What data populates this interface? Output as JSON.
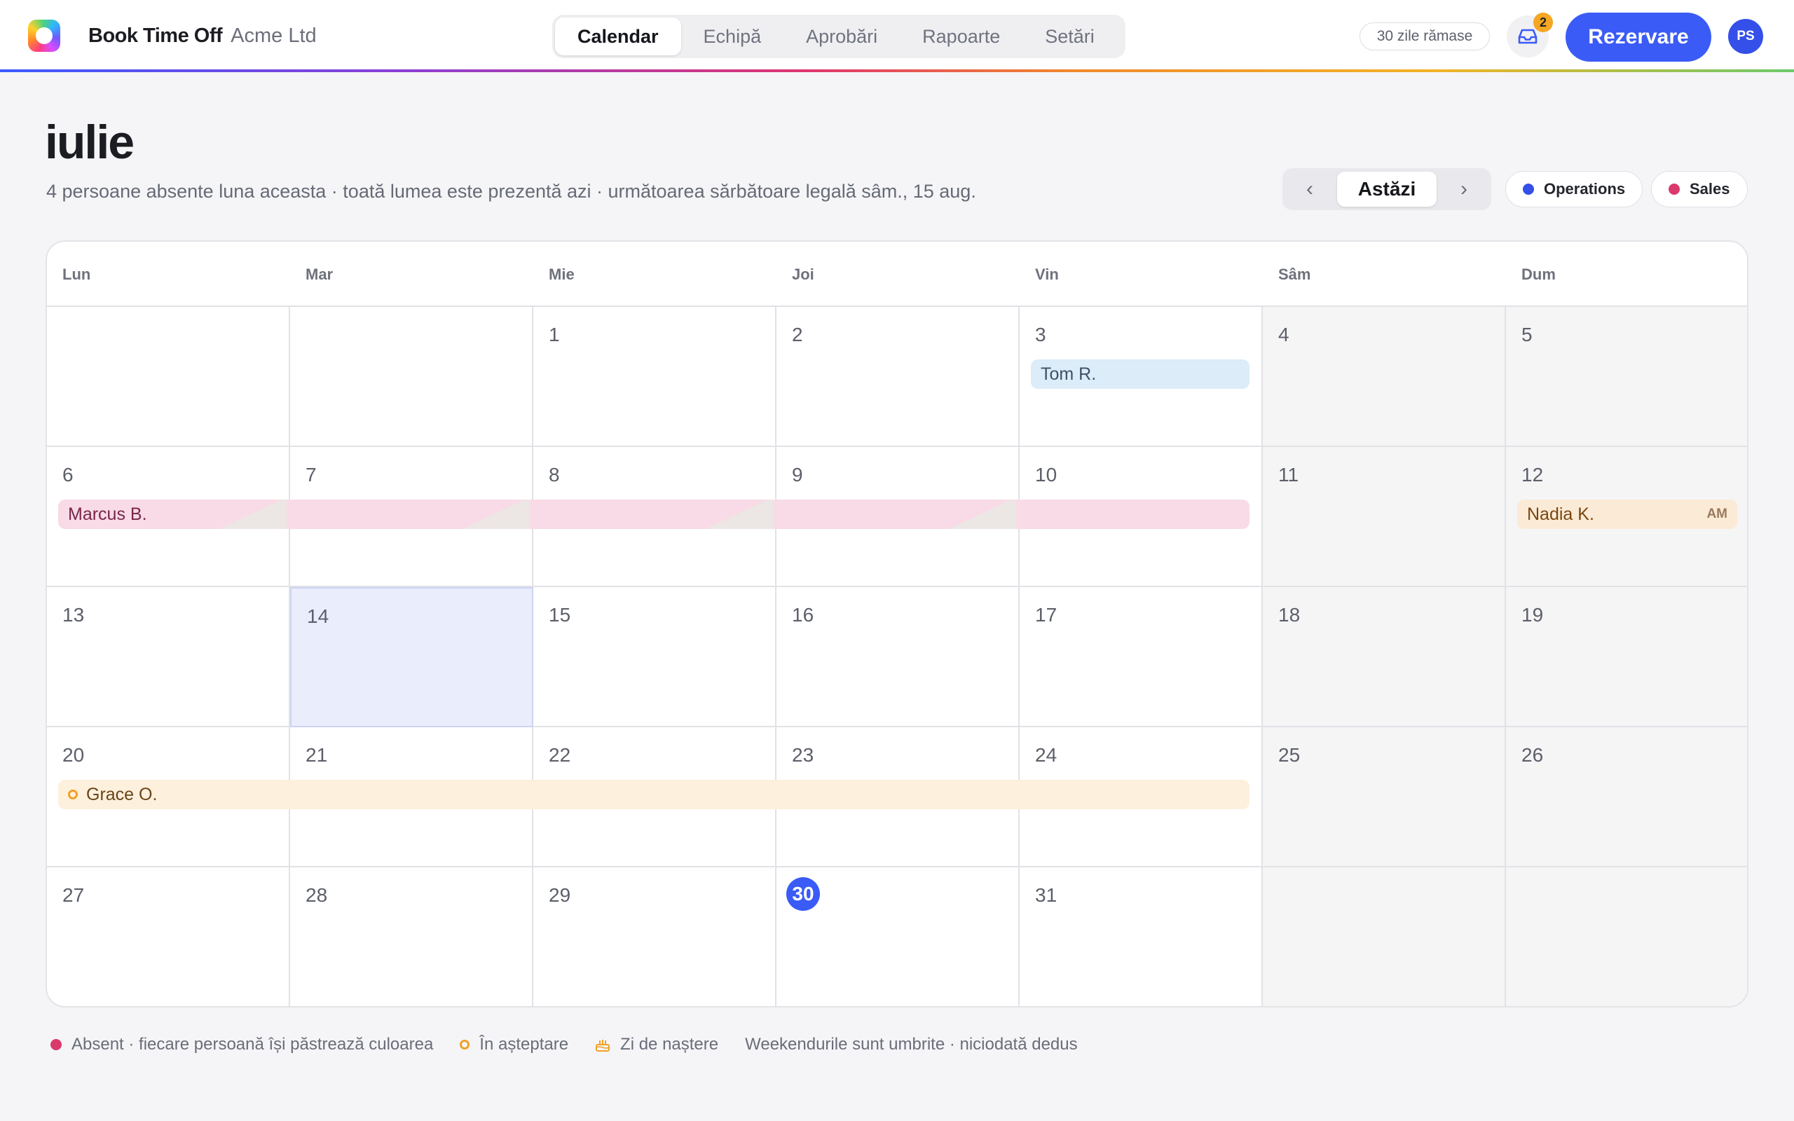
{
  "app": {
    "name": "Book Time Off",
    "org": "Acme Ltd"
  },
  "nav": {
    "tabs": [
      {
        "label": "Calendar",
        "active": true
      },
      {
        "label": "Echipă",
        "active": false
      },
      {
        "label": "Aprobări",
        "active": false
      },
      {
        "label": "Rapoarte",
        "active": false
      },
      {
        "label": "Setări",
        "active": false
      }
    ]
  },
  "header": {
    "days_left": "30 zile rămase",
    "inbox_count": "2",
    "book_label": "Rezervare",
    "avatar_initials": "PS"
  },
  "page": {
    "month": "iulie",
    "subtitle": "4 persoane absente luna aceasta · toată lumea este prezentă azi · următoarea sărbătoare legală sâm., 15 aug.",
    "prev_icon": "‹",
    "today_label": "Astăzi",
    "next_icon": "›",
    "teams": [
      {
        "label": "Operations",
        "color": "#3450e8"
      },
      {
        "label": "Sales",
        "color": "#d93a6b"
      }
    ]
  },
  "calendar": {
    "weekdays": [
      "Lun",
      "Mar",
      "Mie",
      "Joi",
      "Vin",
      "Sâm",
      "Dum"
    ],
    "weeks": [
      [
        "",
        "",
        "1",
        "2",
        "3",
        "4",
        "5"
      ],
      [
        "6",
        "7",
        "8",
        "9",
        "10",
        "11",
        "12"
      ],
      [
        "13",
        "14",
        "15",
        "16",
        "17",
        "18",
        "19"
      ],
      [
        "20",
        "21",
        "22",
        "23",
        "24",
        "25",
        "26"
      ],
      [
        "27",
        "28",
        "29",
        "30",
        "31",
        "",
        ""
      ]
    ],
    "today": "30",
    "highlighted_day": "14",
    "absences": [
      {
        "name": "Tom R."
      },
      {
        "name": "Marcus B."
      },
      {
        "name": "Nadia K.",
        "tag": "AM"
      },
      {
        "name": "Grace O.",
        "status": "pending"
      }
    ]
  },
  "legend": {
    "absent": "Absent · fiecare persoană își păstrează culoarea",
    "pending": "În așteptare",
    "birthday": "Zi de naștere",
    "note": "Weekendurile sunt umbrite · niciodată dedus"
  },
  "colors": {
    "accent": "#3b5bf6",
    "badge": "#f5a623",
    "absent_dot": "#d93a6b",
    "pending_dot": "#f0a126"
  },
  "icons": {
    "logo": "app-logo-icon",
    "inbox": "inbox-icon",
    "birthday": "cake-icon"
  }
}
